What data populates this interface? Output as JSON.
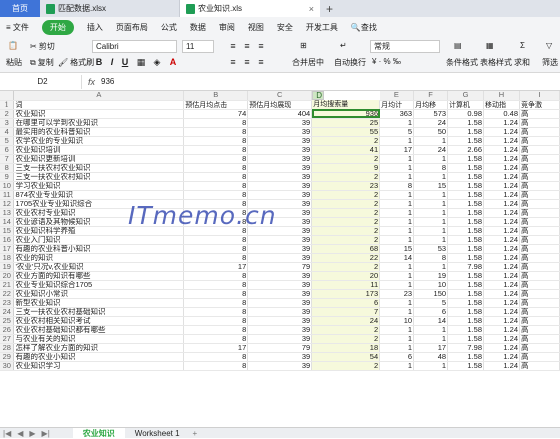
{
  "tabs": {
    "home": "首页",
    "doc1": "匹配数据.xlsx",
    "doc2": "农业知识.xls",
    "close": "×",
    "new": "+"
  },
  "menu": {
    "file": "≡ 文件",
    "start": "开始",
    "insert": "插入",
    "layout": "页面布局",
    "formula": "公式",
    "data": "数据",
    "review": "审阅",
    "view": "视图",
    "security": "安全",
    "dev": "开发工具",
    "search": "查找"
  },
  "toolbar": {
    "cut": "剪切",
    "copy": "复制",
    "paste": "粘贴",
    "format_brush": "格式刷",
    "font": "Calibri",
    "size": "11",
    "merge": "合并居中",
    "wrap": "自动换行",
    "number_format": "常规",
    "cond_format": "条件格式",
    "table_style": "表格样式",
    "sum": "求和",
    "filter": "筛选"
  },
  "formula_bar": {
    "cell": "D2",
    "fx": "fx",
    "value": "936"
  },
  "columns": [
    "A",
    "B",
    "C",
    "D",
    "E",
    "F",
    "G",
    "H",
    "I"
  ],
  "header_row": [
    "词",
    "预估月均点击",
    "预估月均展现",
    "月均搜索量",
    "月均计",
    "月均移",
    "计算机",
    "移动指",
    "竞争激"
  ],
  "rows": [
    [
      "农业知识",
      "74",
      "404",
      "936",
      "363",
      "573",
      "0.98",
      "0.48",
      "高"
    ],
    [
      "在哪里可以学到农业知识",
      "8",
      "39",
      "25",
      "1",
      "24",
      "1.58",
      "1.24",
      "高"
    ],
    [
      "最实用的农业科普知识",
      "8",
      "39",
      "55",
      "5",
      "50",
      "1.58",
      "1.24",
      "高"
    ],
    [
      "农学农业的专业知识",
      "8",
      "39",
      "2",
      "1",
      "1",
      "1.58",
      "1.24",
      "高"
    ],
    [
      "农业知识培训",
      "8",
      "39",
      "41",
      "17",
      "24",
      "2.66",
      "1.24",
      "高"
    ],
    [
      "农业知识更新培训",
      "8",
      "39",
      "2",
      "1",
      "1",
      "1.58",
      "1.24",
      "高"
    ],
    [
      "三支一扶农村农业知识",
      "8",
      "39",
      "9",
      "1",
      "8",
      "1.58",
      "1.24",
      "高"
    ],
    [
      "三支一扶农业农村知识",
      "8",
      "39",
      "2",
      "1",
      "1",
      "1.58",
      "1.24",
      "高"
    ],
    [
      "学习农业知识",
      "8",
      "39",
      "23",
      "8",
      "15",
      "1.58",
      "1.24",
      "高"
    ],
    [
      "874农业专业知识",
      "8",
      "39",
      "2",
      "1",
      "1",
      "1.58",
      "1.24",
      "高"
    ],
    [
      "1705农业专业知识综合",
      "8",
      "39",
      "2",
      "1",
      "1",
      "1.58",
      "1.24",
      "高"
    ],
    [
      "农业农村专业知识",
      "8",
      "39",
      "2",
      "1",
      "1",
      "1.58",
      "1.24",
      "高"
    ],
    [
      "农业谚语及其物候知识",
      "8",
      "39",
      "2",
      "1",
      "1",
      "1.58",
      "1.24",
      "高"
    ],
    [
      "农业知识科学养殖",
      "8",
      "39",
      "2",
      "1",
      "1",
      "1.58",
      "1.24",
      "高"
    ],
    [
      "农业入门知识",
      "8",
      "39",
      "2",
      "1",
      "1",
      "1.58",
      "1.24",
      "高"
    ],
    [
      "有趣的农业科普小知识",
      "8",
      "39",
      "68",
      "15",
      "53",
      "1.58",
      "1.24",
      "高"
    ],
    [
      "农业的知识",
      "8",
      "39",
      "22",
      "14",
      "8",
      "1.58",
      "1.24",
      "高"
    ],
    [
      "'农业'只况v,农业知识",
      "17",
      "79",
      "2",
      "1",
      "1",
      "7.98",
      "1.24",
      "高"
    ],
    [
      "农业方面的知识有哪些",
      "8",
      "39",
      "20",
      "1",
      "19",
      "1.58",
      "1.24",
      "高"
    ],
    [
      "农业专业知识综合1705",
      "8",
      "39",
      "11",
      "1",
      "10",
      "1.58",
      "1.24",
      "高"
    ],
    [
      "农业知识小常识",
      "8",
      "39",
      "173",
      "23",
      "150",
      "1.58",
      "1.24",
      "高"
    ],
    [
      "新型农业知识",
      "8",
      "39",
      "6",
      "1",
      "5",
      "1.58",
      "1.24",
      "高"
    ],
    [
      "三支一扶农业农村基础知识",
      "8",
      "39",
      "7",
      "1",
      "6",
      "1.58",
      "1.24",
      "高"
    ],
    [
      "农业农村相关知识考试",
      "8",
      "39",
      "24",
      "10",
      "14",
      "1.58",
      "1.24",
      "高"
    ],
    [
      "农业农村基础知识都有哪些",
      "8",
      "39",
      "2",
      "1",
      "1",
      "1.58",
      "1.24",
      "高"
    ],
    [
      "与农业有关的知识",
      "8",
      "39",
      "2",
      "1",
      "1",
      "1.58",
      "1.24",
      "高"
    ],
    [
      "怎样了解农业方面的知识",
      "17",
      "79",
      "18",
      "1",
      "17",
      "7.98",
      "1.24",
      "高"
    ],
    [
      "有趣的农业小知识",
      "8",
      "39",
      "54",
      "6",
      "48",
      "1.58",
      "1.24",
      "高"
    ],
    [
      "农业知识学习",
      "8",
      "39",
      "2",
      "1",
      "1",
      "1.58",
      "1.24",
      "高"
    ]
  ],
  "watermark": "ITmemo.cn",
  "sheets": [
    "农业知识",
    "Worksheet 1"
  ],
  "sheet_add": "+"
}
